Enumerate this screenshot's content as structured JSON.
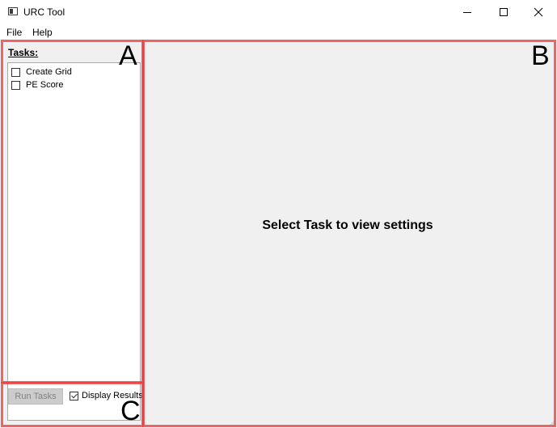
{
  "window": {
    "title": "URC Tool"
  },
  "menu": {
    "items": [
      "File",
      "Help"
    ]
  },
  "tasks": {
    "label": "Tasks:",
    "items": [
      {
        "label": "Create Grid",
        "checked": false
      },
      {
        "label": "PE Score",
        "checked": false
      }
    ]
  },
  "controls": {
    "run_label": "Run Tasks",
    "run_enabled": false,
    "display_results_label": "Display Results",
    "display_results_checked": true
  },
  "settings_panel": {
    "placeholder": "Select Task to view settings"
  },
  "annotations": {
    "labels": [
      "A",
      "B",
      "C"
    ],
    "color": "#eb3c3c"
  }
}
